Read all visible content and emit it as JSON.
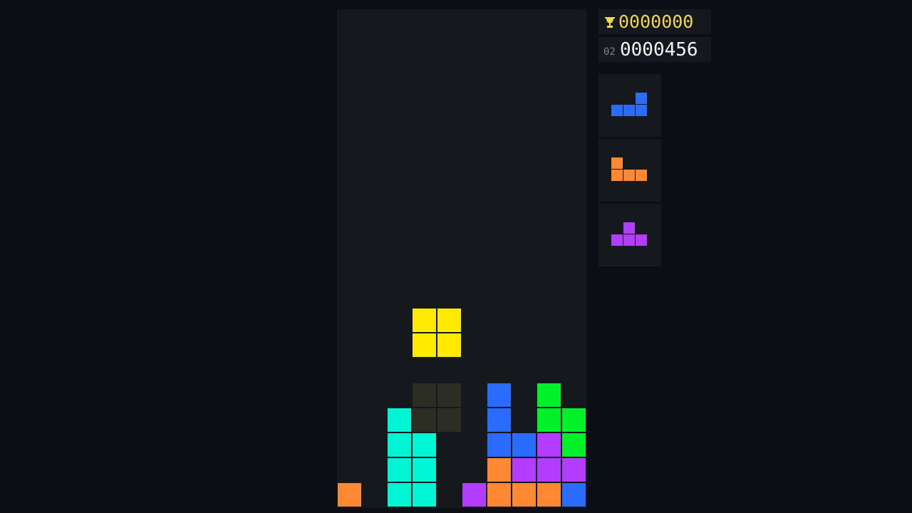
{
  "colors": {
    "I": "#00f5d4",
    "O": "#ffea00",
    "J": "#2a6cff",
    "L": "#ff8833",
    "T": "#b23cff",
    "S": "#00f02a",
    "ghost": "#2d2e23"
  },
  "hiscore": {
    "icon": "trophy-icon",
    "value": "0000000"
  },
  "score": {
    "level": "02",
    "value": "0000456"
  },
  "board": {
    "cols": 10,
    "rows": 20,
    "locked": [
      {
        "col": 2,
        "row": 16,
        "type": "I"
      },
      {
        "col": 2,
        "row": 17,
        "type": "I"
      },
      {
        "col": 3,
        "row": 17,
        "type": "I"
      },
      {
        "col": 2,
        "row": 18,
        "type": "I"
      },
      {
        "col": 3,
        "row": 18,
        "type": "I"
      },
      {
        "col": 2,
        "row": 19,
        "type": "I"
      },
      {
        "col": 3,
        "row": 19,
        "type": "I"
      },
      {
        "col": 0,
        "row": 19,
        "type": "L"
      },
      {
        "col": 5,
        "row": 19,
        "type": "T"
      },
      {
        "col": 6,
        "row": 15,
        "type": "J"
      },
      {
        "col": 6,
        "row": 16,
        "type": "J"
      },
      {
        "col": 6,
        "row": 17,
        "type": "J"
      },
      {
        "col": 7,
        "row": 17,
        "type": "J"
      },
      {
        "col": 8,
        "row": 15,
        "type": "S"
      },
      {
        "col": 8,
        "row": 16,
        "type": "S"
      },
      {
        "col": 9,
        "row": 16,
        "type": "S"
      },
      {
        "col": 9,
        "row": 17,
        "type": "S"
      },
      {
        "col": 8,
        "row": 17,
        "type": "T"
      },
      {
        "col": 7,
        "row": 18,
        "type": "T"
      },
      {
        "col": 8,
        "row": 18,
        "type": "T"
      },
      {
        "col": 9,
        "row": 18,
        "type": "T"
      },
      {
        "col": 6,
        "row": 18,
        "type": "L"
      },
      {
        "col": 6,
        "row": 19,
        "type": "L"
      },
      {
        "col": 7,
        "row": 19,
        "type": "L"
      },
      {
        "col": 8,
        "row": 19,
        "type": "L"
      },
      {
        "col": 9,
        "row": 19,
        "type": "J"
      }
    ],
    "active": {
      "type": "O",
      "cells": [
        {
          "col": 3,
          "row": 12
        },
        {
          "col": 4,
          "row": 12
        },
        {
          "col": 3,
          "row": 13
        },
        {
          "col": 4,
          "row": 13
        }
      ]
    },
    "ghost": {
      "cells": [
        {
          "col": 3,
          "row": 15
        },
        {
          "col": 4,
          "row": 15
        },
        {
          "col": 3,
          "row": 16
        },
        {
          "col": 4,
          "row": 16
        }
      ]
    }
  },
  "next_queue": [
    {
      "type": "J",
      "cells": [
        {
          "col": 2,
          "row": 0
        },
        {
          "col": 0,
          "row": 1
        },
        {
          "col": 1,
          "row": 1
        },
        {
          "col": 2,
          "row": 1
        }
      ]
    },
    {
      "type": "L",
      "cells": [
        {
          "col": 0,
          "row": 0
        },
        {
          "col": 0,
          "row": 1
        },
        {
          "col": 1,
          "row": 1
        },
        {
          "col": 2,
          "row": 1
        }
      ]
    },
    {
      "type": "T",
      "cells": [
        {
          "col": 1,
          "row": 0
        },
        {
          "col": 0,
          "row": 1
        },
        {
          "col": 1,
          "row": 1
        },
        {
          "col": 2,
          "row": 1
        }
      ]
    }
  ]
}
